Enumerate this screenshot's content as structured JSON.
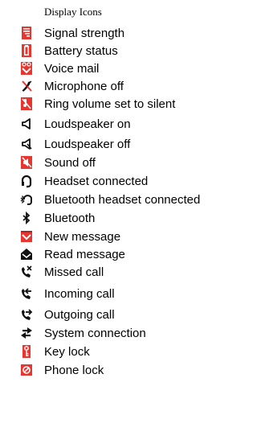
{
  "title": "Display Icons",
  "colors": {
    "red": "#e8352f",
    "black": "#111111",
    "white": "#ffffff"
  },
  "icons": [
    {
      "label": "Signal strength",
      "icon": "signal-strength-icon"
    },
    {
      "label": "Battery status",
      "icon": "battery-status-icon"
    },
    {
      "label": "Voice mail",
      "icon": "voice-mail-icon"
    },
    {
      "label": "Microphone off",
      "icon": "microphone-off-icon"
    },
    {
      "label": "Ring volume set to silent",
      "icon": "ring-silent-icon"
    },
    {
      "label": "Loudspeaker on",
      "icon": "loudspeaker-on-icon"
    },
    {
      "label": "Loudspeaker off",
      "icon": "loudspeaker-off-icon"
    },
    {
      "label": "Sound off",
      "icon": "sound-off-icon"
    },
    {
      "label": "Headset connected",
      "icon": "headset-icon"
    },
    {
      "label": "Bluetooth headset connected",
      "icon": "bluetooth-headset-icon"
    },
    {
      "label": "Bluetooth",
      "icon": "bluetooth-icon"
    },
    {
      "label": "New message",
      "icon": "new-message-icon"
    },
    {
      "label": "Read message",
      "icon": "read-message-icon"
    },
    {
      "label": "Missed call",
      "icon": "missed-call-icon"
    },
    {
      "label": "Incoming call",
      "icon": "incoming-call-icon"
    },
    {
      "label": "Outgoing call",
      "icon": "outgoing-call-icon"
    },
    {
      "label": "System connection",
      "icon": "system-connection-icon"
    },
    {
      "label": "Key lock",
      "icon": "key-lock-icon"
    },
    {
      "label": "Phone lock",
      "icon": "phone-lock-icon"
    }
  ]
}
